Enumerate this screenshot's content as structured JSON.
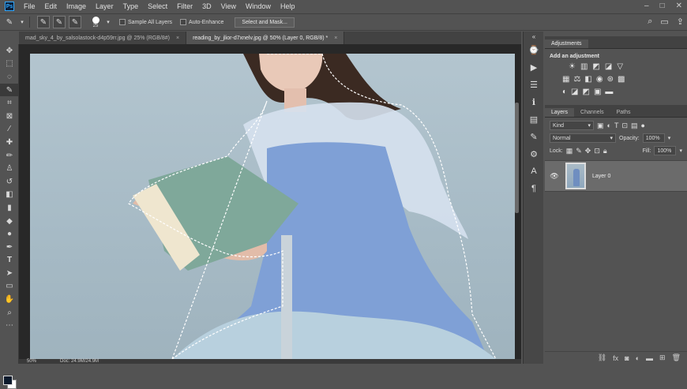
{
  "menubar": {
    "logo": "Ps",
    "items": [
      "File",
      "Edit",
      "Image",
      "Layer",
      "Type",
      "Select",
      "Filter",
      "3D",
      "View",
      "Window",
      "Help"
    ]
  },
  "optionsbar": {
    "brush_size": "25",
    "sample_all_layers": "Sample All Layers",
    "auto_enhance": "Auto-Enhance",
    "select_mask": "Select and Mask..."
  },
  "tabs": [
    {
      "label": "mad_sky_4_by_salsolastock-d4p59rr.jpg @ 25% (RGB/8#)",
      "close": "×"
    },
    {
      "label": "reading_by_jlior-d7xnelv.jpg @ 50% (Layer 0, RGB/8) *",
      "close": "×"
    }
  ],
  "status": {
    "zoom": "50%",
    "doc": "Doc: 24.9M/24.9M"
  },
  "adjustments": {
    "tab": "Adjustments",
    "title": "Add an adjustment"
  },
  "layers": {
    "tabs": [
      "Layers",
      "Channels",
      "Paths"
    ],
    "kind": "Kind",
    "blend_mode": "Normal",
    "opacity_label": "Opacity:",
    "opacity_value": "100%",
    "lock_label": "Lock:",
    "fill_label": "Fill:",
    "fill_value": "100%",
    "layer_name": "Layer 0"
  },
  "colors": {
    "foreground": "#0c1a2c",
    "background": "#ffffff"
  }
}
